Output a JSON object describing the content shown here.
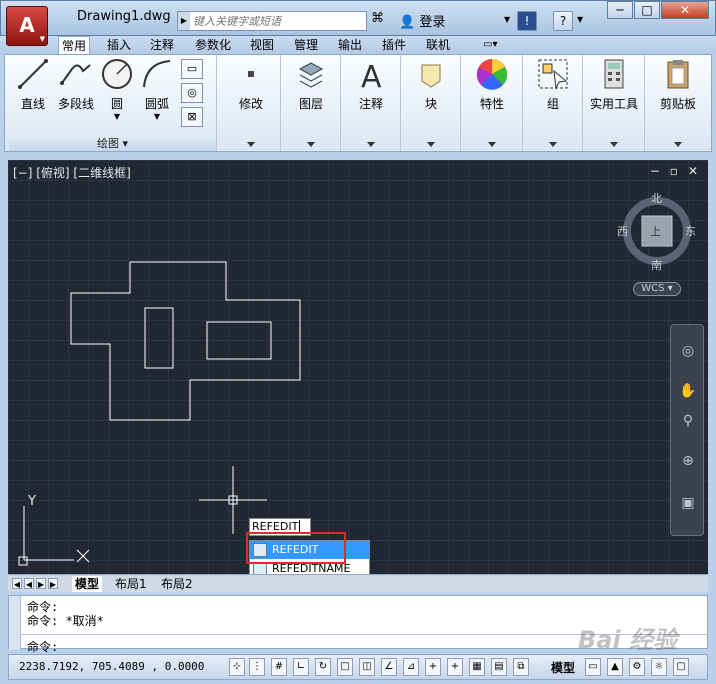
{
  "window": {
    "title": "Drawing1.dwg",
    "minimize": "─",
    "maximize": "□",
    "close": "✕"
  },
  "app_button": {
    "label": "A"
  },
  "search": {
    "placeholder": "键入关键字或短语"
  },
  "user": {
    "login": "登录"
  },
  "help": {
    "label": "?",
    "exchange": "!"
  },
  "tabs": [
    {
      "label": "常用",
      "active": true
    },
    {
      "label": "插入"
    },
    {
      "label": "注释"
    },
    {
      "label": "参数化"
    },
    {
      "label": "视图"
    },
    {
      "label": "管理"
    },
    {
      "label": "输出"
    },
    {
      "label": "插件"
    },
    {
      "label": "联机"
    }
  ],
  "ribbon": {
    "draw_tools": [
      "直线",
      "多段线",
      "圆",
      "圆弧"
    ],
    "draw_panel": "绘图",
    "panels": [
      {
        "label": "修改"
      },
      {
        "label": "图层"
      },
      {
        "label": "注释"
      },
      {
        "label": "块"
      },
      {
        "label": "特性"
      },
      {
        "label": "组"
      },
      {
        "label": "实用工具"
      },
      {
        "label": "剪贴板"
      }
    ]
  },
  "viewport": {
    "label": "[−] [俯视] [二维线框]",
    "controls": [
      "−",
      "▫",
      "✕"
    ],
    "compass": {
      "north": "北",
      "south": "南",
      "east": "东",
      "west": "西",
      "center": "上"
    },
    "wcs": "WCS",
    "axis_y": "Y",
    "command_typed": "REFEDIT",
    "suggestions": [
      "REFEDIT",
      "REFEDITNAME"
    ]
  },
  "layout_tabs": [
    {
      "label": "模型",
      "active": true
    },
    {
      "label": "布局1"
    },
    {
      "label": "布局2"
    }
  ],
  "command_history": [
    "命令:",
    "命令: *取消*"
  ],
  "command_prompt": "命令:",
  "status": {
    "coordinates": "2238.7192, 705.4089 , 0.0000",
    "model_label": "模型"
  },
  "watermark": "Bai 经验",
  "colors": {
    "accent": "#3399ff",
    "viewport_bg": "#212834",
    "highlight_box": "#e32a2a"
  }
}
